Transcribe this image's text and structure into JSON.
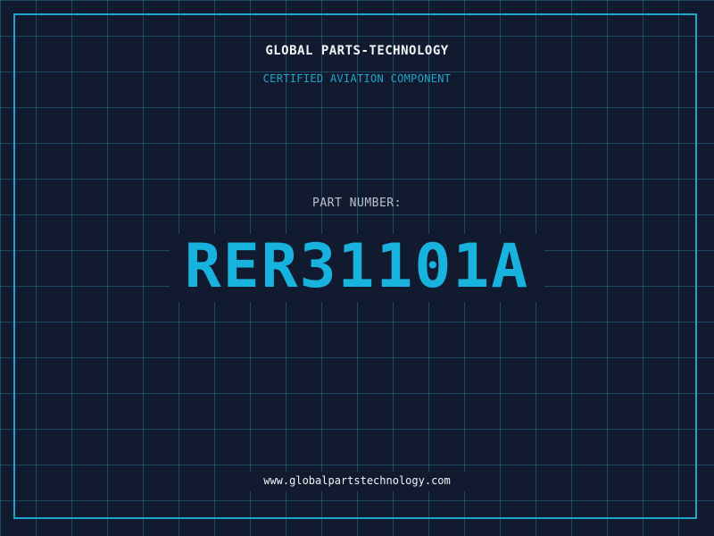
{
  "header": {
    "company": "GLOBAL PARTS-TECHNOLOGY",
    "tagline": "CERTIFIED AVIATION COMPONENT"
  },
  "part": {
    "label": "PART NUMBER:",
    "number": "RER31101A"
  },
  "footer": {
    "url": "www.globalpartstechnology.com"
  },
  "colors": {
    "background": "#111a2e",
    "grid": "#266e8c",
    "accent": "#1da6c9",
    "part_number": "#17b3de",
    "text": "#f2f4f7",
    "muted_text": "#b9c3d0"
  }
}
